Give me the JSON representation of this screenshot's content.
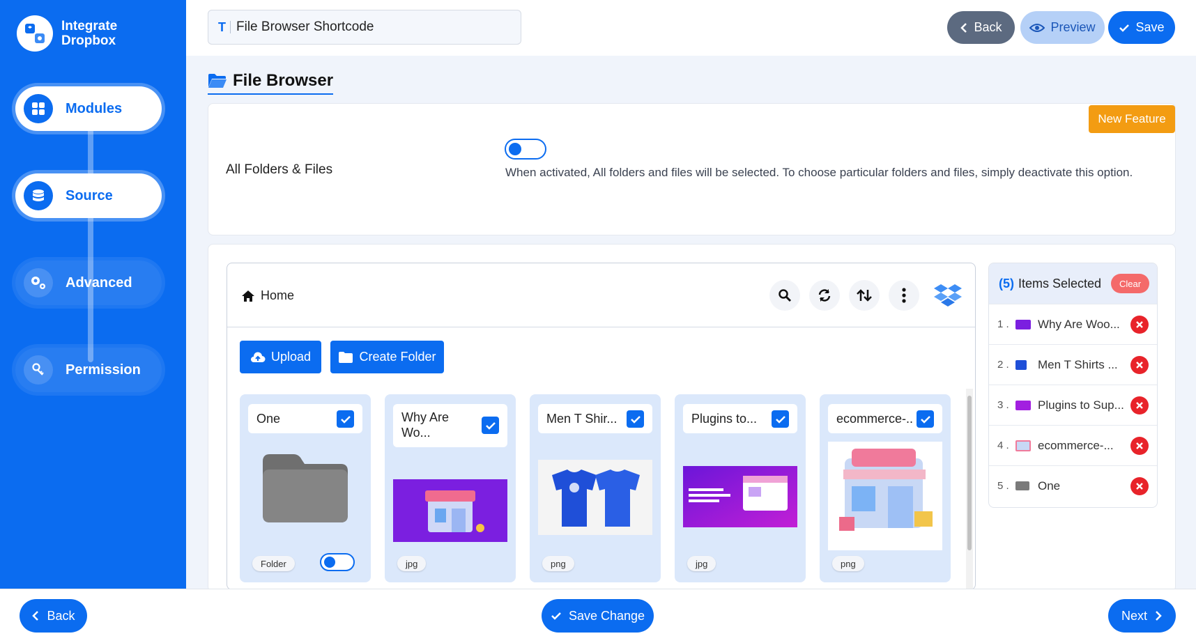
{
  "brand": {
    "line1": "Integrate",
    "line2": "Dropbox"
  },
  "steps": [
    {
      "label": "Modules",
      "icon": "grid-icon",
      "active": true
    },
    {
      "label": "Source",
      "icon": "database-icon",
      "active": true
    },
    {
      "label": "Advanced",
      "icon": "gears-icon",
      "active": false
    },
    {
      "label": "Permission",
      "icon": "key-icon",
      "active": false
    }
  ],
  "header": {
    "title_value": "File Browser Shortcode",
    "back_label": "Back",
    "preview_label": "Preview",
    "save_label": "Save"
  },
  "page": {
    "title": "File Browser"
  },
  "settings": {
    "new_feature_label": "New Feature",
    "all_folders_label": "All Folders & Files",
    "all_folders_desc": "When activated, All folders and files will be selected. To choose particular folders and files, simply deactivate this option.",
    "all_folders_enabled": false
  },
  "browser": {
    "breadcrumb": "Home",
    "upload_label": "Upload",
    "create_folder_label": "Create Folder",
    "files": [
      {
        "name": "One",
        "type": "Folder",
        "checked": true
      },
      {
        "name": "Why Are Wo...",
        "type": "jpg",
        "checked": true
      },
      {
        "name": "Men T Shir...",
        "type": "png",
        "checked": true
      },
      {
        "name": "Plugins to...",
        "type": "jpg",
        "checked": true
      },
      {
        "name": "ecommerce-...",
        "type": "png",
        "checked": true
      }
    ]
  },
  "selected": {
    "count": "(5)",
    "label": "Items Selected",
    "clear_label": "Clear",
    "items": [
      {
        "num": "1 .",
        "name": "Why Are Woo..."
      },
      {
        "num": "2 .",
        "name": "Men T Shirts ..."
      },
      {
        "num": "3 .",
        "name": "Plugins to Sup..."
      },
      {
        "num": "4 .",
        "name": "ecommerce-..."
      },
      {
        "num": "5 .",
        "name": "One"
      }
    ]
  },
  "footer": {
    "back_label": "Back",
    "save_change_label": "Save Change",
    "next_label": "Next"
  },
  "colors": {
    "primary": "#0b6cf0",
    "warning": "#f39c12",
    "danger": "#e8232a"
  }
}
